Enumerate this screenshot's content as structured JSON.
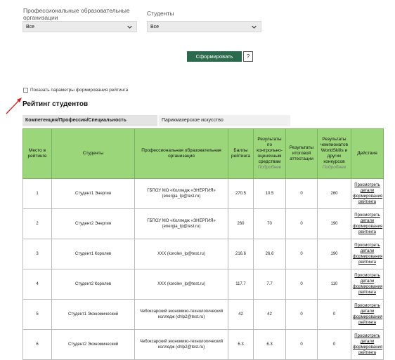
{
  "filters": {
    "org": {
      "label": "Профессиональные образовательные организации",
      "value": "Все"
    },
    "students": {
      "label": "Студенты",
      "value": "Все"
    }
  },
  "buttons": {
    "form": "Сформировать",
    "help": "?"
  },
  "show_params": "Показать параметры формирования рейтинга",
  "title": "Рейтинг студентов",
  "competence": {
    "key": "Компетенция/Профессия/Специальность",
    "value": "Парикмахерское искусство"
  },
  "table": {
    "headers": {
      "place": "Место в рейтинге",
      "student": "Студенты",
      "org": "Профессиональная образовательная организация",
      "score": "Баллы рейтинга",
      "control": "Результаты по контрольно-оценочным средствам",
      "control_more": "Подробнее",
      "attestation": "Результаты итоговой аттестации",
      "worldskills": "Результаты чемпионатов WorldSkills и других конкурсов",
      "worldskills_more": "Подробнее",
      "actions": "Действия"
    },
    "rows": [
      {
        "place": "1",
        "student": "Студент1 Энергия",
        "org": "ГБПОУ МО «Колледж «ЭНЕРГИЯ» (energia_lp@test.ru)",
        "score": "270.5",
        "control": "10.5",
        "attestation": "0",
        "worldskills": "260",
        "action": "Просмотреть детали формирования рейтинга"
      },
      {
        "place": "2",
        "student": "Студент2 Энергия",
        "org": "ГБПОУ МО «Колледж «ЭНЕРГИЯ» (energia_lp@test.ru)",
        "score": "260",
        "control": "70",
        "attestation": "0",
        "worldskills": "190",
        "action": "Просмотреть детали формирования рейтинга"
      },
      {
        "place": "3",
        "student": "Студент1 Королев",
        "org": "XXX (korolev_lp@test.ru)",
        "score": "216.6",
        "control": "26.6",
        "attestation": "0",
        "worldskills": "190",
        "action": "Просмотреть детали формирования рейтинга"
      },
      {
        "place": "4",
        "student": "Студент2 Королев",
        "org": "XXX (korolev_lp@test.ru)",
        "score": "117.7",
        "control": "7.7",
        "attestation": "0",
        "worldskills": "110",
        "action": "Просмотреть детали формирования рейтинга"
      },
      {
        "place": "5",
        "student": "Студент1 Экономический",
        "org": "Чебоксарский экономико-технологический колледж (chlp2@test.ru)",
        "score": "42",
        "control": "42",
        "attestation": "0",
        "worldskills": "0",
        "action": "Просмотреть детали формирования рейтинга"
      },
      {
        "place": "6",
        "student": "Студент2 Экономический",
        "org": "Чебоксарский экономико-технологический колледж (chlp2@test.ru)",
        "score": "6.3",
        "control": "6.3",
        "attestation": "0",
        "worldskills": "0",
        "action": "Просмотреть детали формирования рейтинга"
      }
    ]
  },
  "colors": {
    "header_green": "#9bd77a",
    "button_green": "#2b6a4c",
    "arrow_red": "#cc2222"
  }
}
